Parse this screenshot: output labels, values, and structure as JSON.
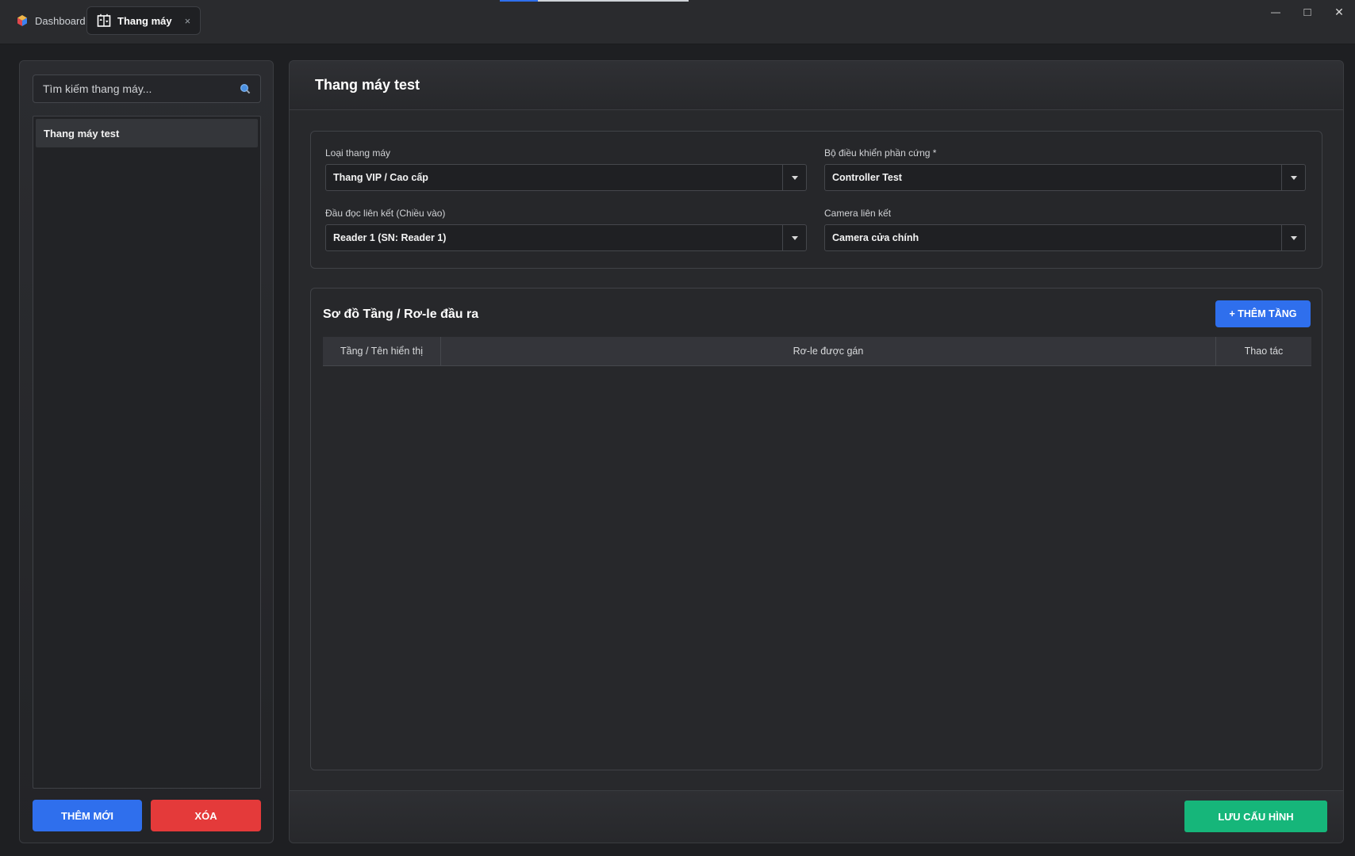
{
  "titlebar": {
    "tabs": [
      {
        "label": "Dashboard",
        "icon": "cube-logo-icon",
        "active": false
      },
      {
        "label": "Thang máy",
        "icon": "elevator-icon",
        "active": true
      }
    ],
    "close_tab_glyph": "×",
    "window_controls": {
      "minimize": "—",
      "maximize": "□",
      "close": "✕"
    }
  },
  "sidebar": {
    "search": {
      "placeholder": "Tìm kiếm thang máy...",
      "value": ""
    },
    "items": [
      {
        "label": "Thang máy test",
        "selected": true
      }
    ],
    "add_button": "THÊM MỚI",
    "delete_button": "XÓA"
  },
  "main": {
    "title": "Thang máy test",
    "fields": {
      "elevator_type": {
        "label": "Loại thang máy",
        "value": "Thang VIP / Cao cấp"
      },
      "hardware_controller": {
        "label": "Bộ điều khiển phần cứng *",
        "value": "Controller Test"
      },
      "reader": {
        "label": "Đầu đọc liên kết (Chiều vào)",
        "value": "Reader 1 (SN: Reader 1)"
      },
      "camera": {
        "label": "Camera liên kết",
        "value": "Camera cửa chính"
      }
    },
    "floor_section": {
      "title": "Sơ đồ Tầng / Rơ-le đầu ra",
      "add_floor_button": "+ THÊM TẦNG",
      "columns": [
        "Tầng / Tên hiển thị",
        "Rơ-le được gán",
        "Thao tác"
      ],
      "rows": []
    },
    "save_button": "LƯU CẤU HÌNH"
  },
  "colors": {
    "primary_blue": "#2f6fed",
    "danger_red": "#e43a3a",
    "success_green": "#16b67a",
    "background": "#1e1f22"
  }
}
